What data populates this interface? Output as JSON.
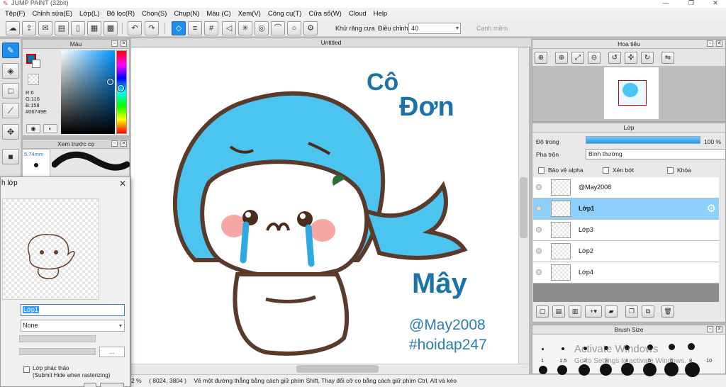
{
  "window": {
    "title": "JUMP PAINT (32bit)",
    "minimize": "—",
    "restore": "❐",
    "close": "✕"
  },
  "menu": [
    "Tệp(F)",
    "Chỉnh sửa(E)",
    "Lớp(L)",
    "Bộ lọc(R)",
    "Chọn(S)",
    "Chụp(N)",
    "Màu (C)",
    "Xem(V)",
    "Công cụ(T)",
    "Cửa sổ(W)",
    "Cloud",
    "Help"
  ],
  "toolbar": {
    "antialias_label": "Khử răng cưa",
    "adjust_label": "Điều chỉnh",
    "adjust_value": "40",
    "smooth_label": "Cạnh mềm"
  },
  "color_panel": {
    "title": "Màu",
    "r": "R:6",
    "g": "G:116",
    "b": "B:158",
    "hex": "#06749E",
    "fg_color": "#06749E"
  },
  "brush_preview": {
    "title": "Xem trước cọ",
    "size": "5.74mm"
  },
  "document": {
    "tab": "Untitled"
  },
  "artwork": {
    "text_co": "Cô",
    "text_don": "Đơn",
    "text_may": "Mây",
    "handle": "@May2008",
    "hashtag": "#hoidap247"
  },
  "status": {
    "zoom": "2 %",
    "coords": "( 8024, 3804 )",
    "hint": "Vẽ một đường thẳng bằng cách giữ phím Shift, Thay đổi cỡ cọ bằng cách giữ phím Ctrl, Alt và kéo"
  },
  "navigator": {
    "title": "Hoa tiêu"
  },
  "layer_panel": {
    "title": "Lớp",
    "opacity_label": "Độ trong",
    "opacity_value": "100 %",
    "opacity": 1.0,
    "blend_label": "Pha trộn",
    "blend_value": "Bình thường",
    "protect_alpha": "Bảo vệ alpha",
    "clipping": "Xén bớt",
    "lock": "Khóa",
    "layers": [
      {
        "name": "@May2008",
        "selected": false
      },
      {
        "name": "Lớp1",
        "selected": true
      },
      {
        "name": "Lớp3",
        "selected": false
      },
      {
        "name": "Lớp2",
        "selected": false
      },
      {
        "name": "Lớp4",
        "selected": false
      }
    ]
  },
  "brush_size": {
    "title": "Brush Size",
    "sizes": [
      "1",
      "1.5",
      "2",
      "3",
      "4",
      "5",
      "6",
      "8",
      "10"
    ]
  },
  "watermark": {
    "line1": "Activate Windows",
    "line2": "Go to Settings to activate Windows."
  },
  "dialog": {
    "title": "h lớp",
    "close": "✕",
    "name_value": "Lớp1",
    "blend_value": "None",
    "more_button": "...",
    "draft_label_1": "Lớp phác thảo",
    "draft_label_2": "(Submit Hide when rasterizing)"
  }
}
